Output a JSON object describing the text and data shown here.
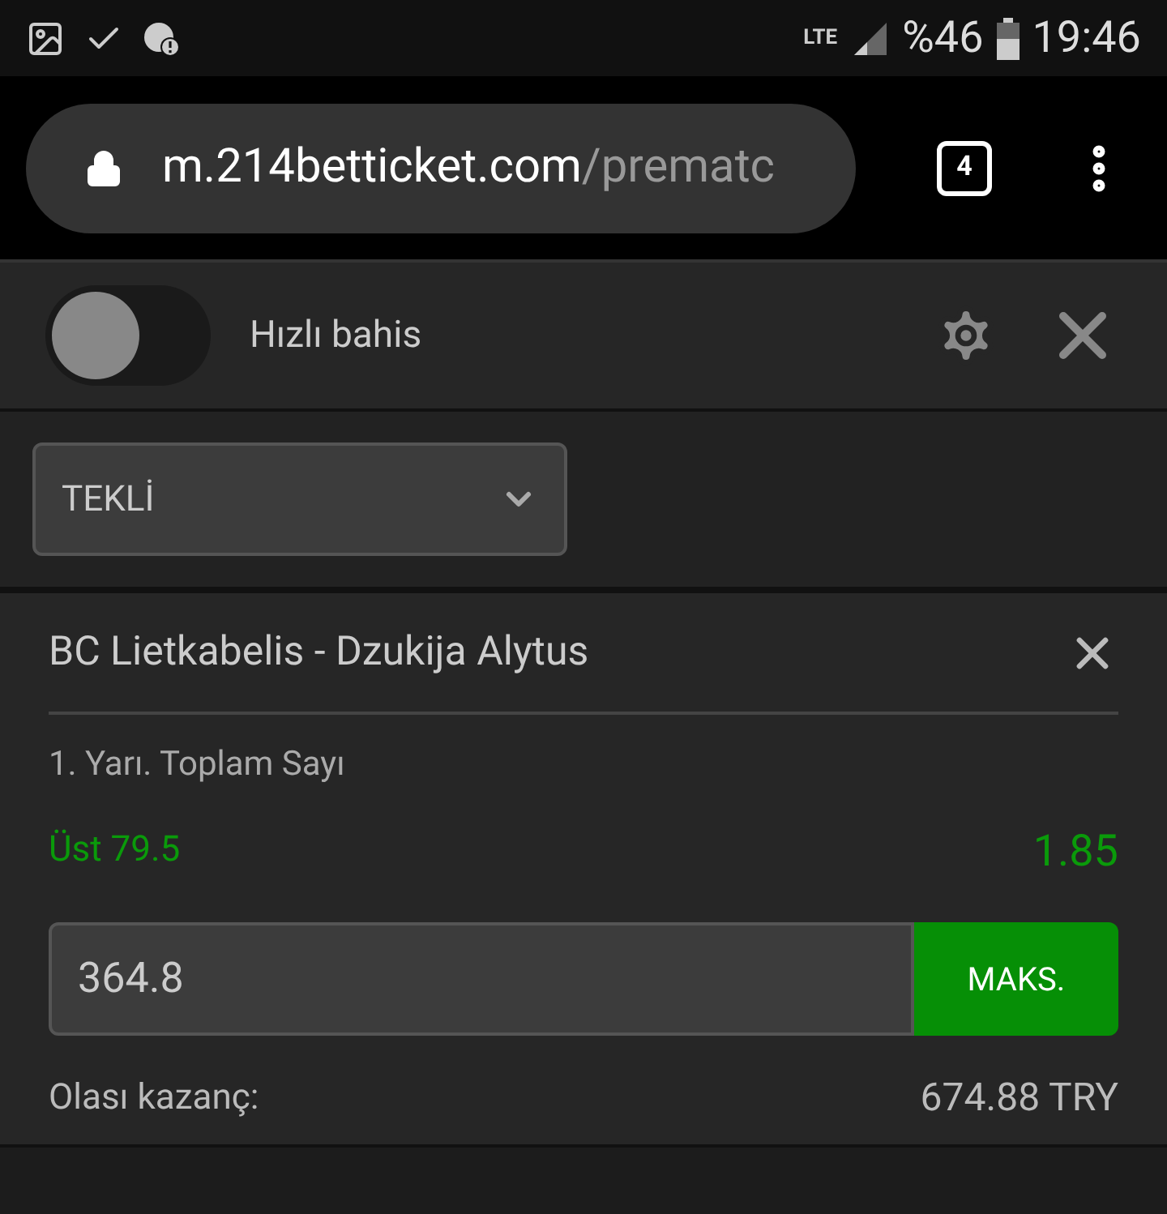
{
  "status_bar": {
    "network": "LTE",
    "battery": "%46",
    "time": "19:46"
  },
  "browser": {
    "host": "m.214betticket.com",
    "path": "/prematc",
    "tab_count": "4"
  },
  "quick_bet": {
    "label": "Hızlı bahis",
    "on": false
  },
  "bet_type": {
    "value": "TEKLİ"
  },
  "bet": {
    "match": "BC Lietkabelis - Dzukija Alytus",
    "market": "1. Yarı. Toplam Sayı",
    "selection": "Üst 79.5",
    "odds": "1.85",
    "stake": "364.8",
    "max_button": "MAKS.",
    "payout_label": "Olası kazanç:",
    "payout": "674.88 TRY"
  }
}
